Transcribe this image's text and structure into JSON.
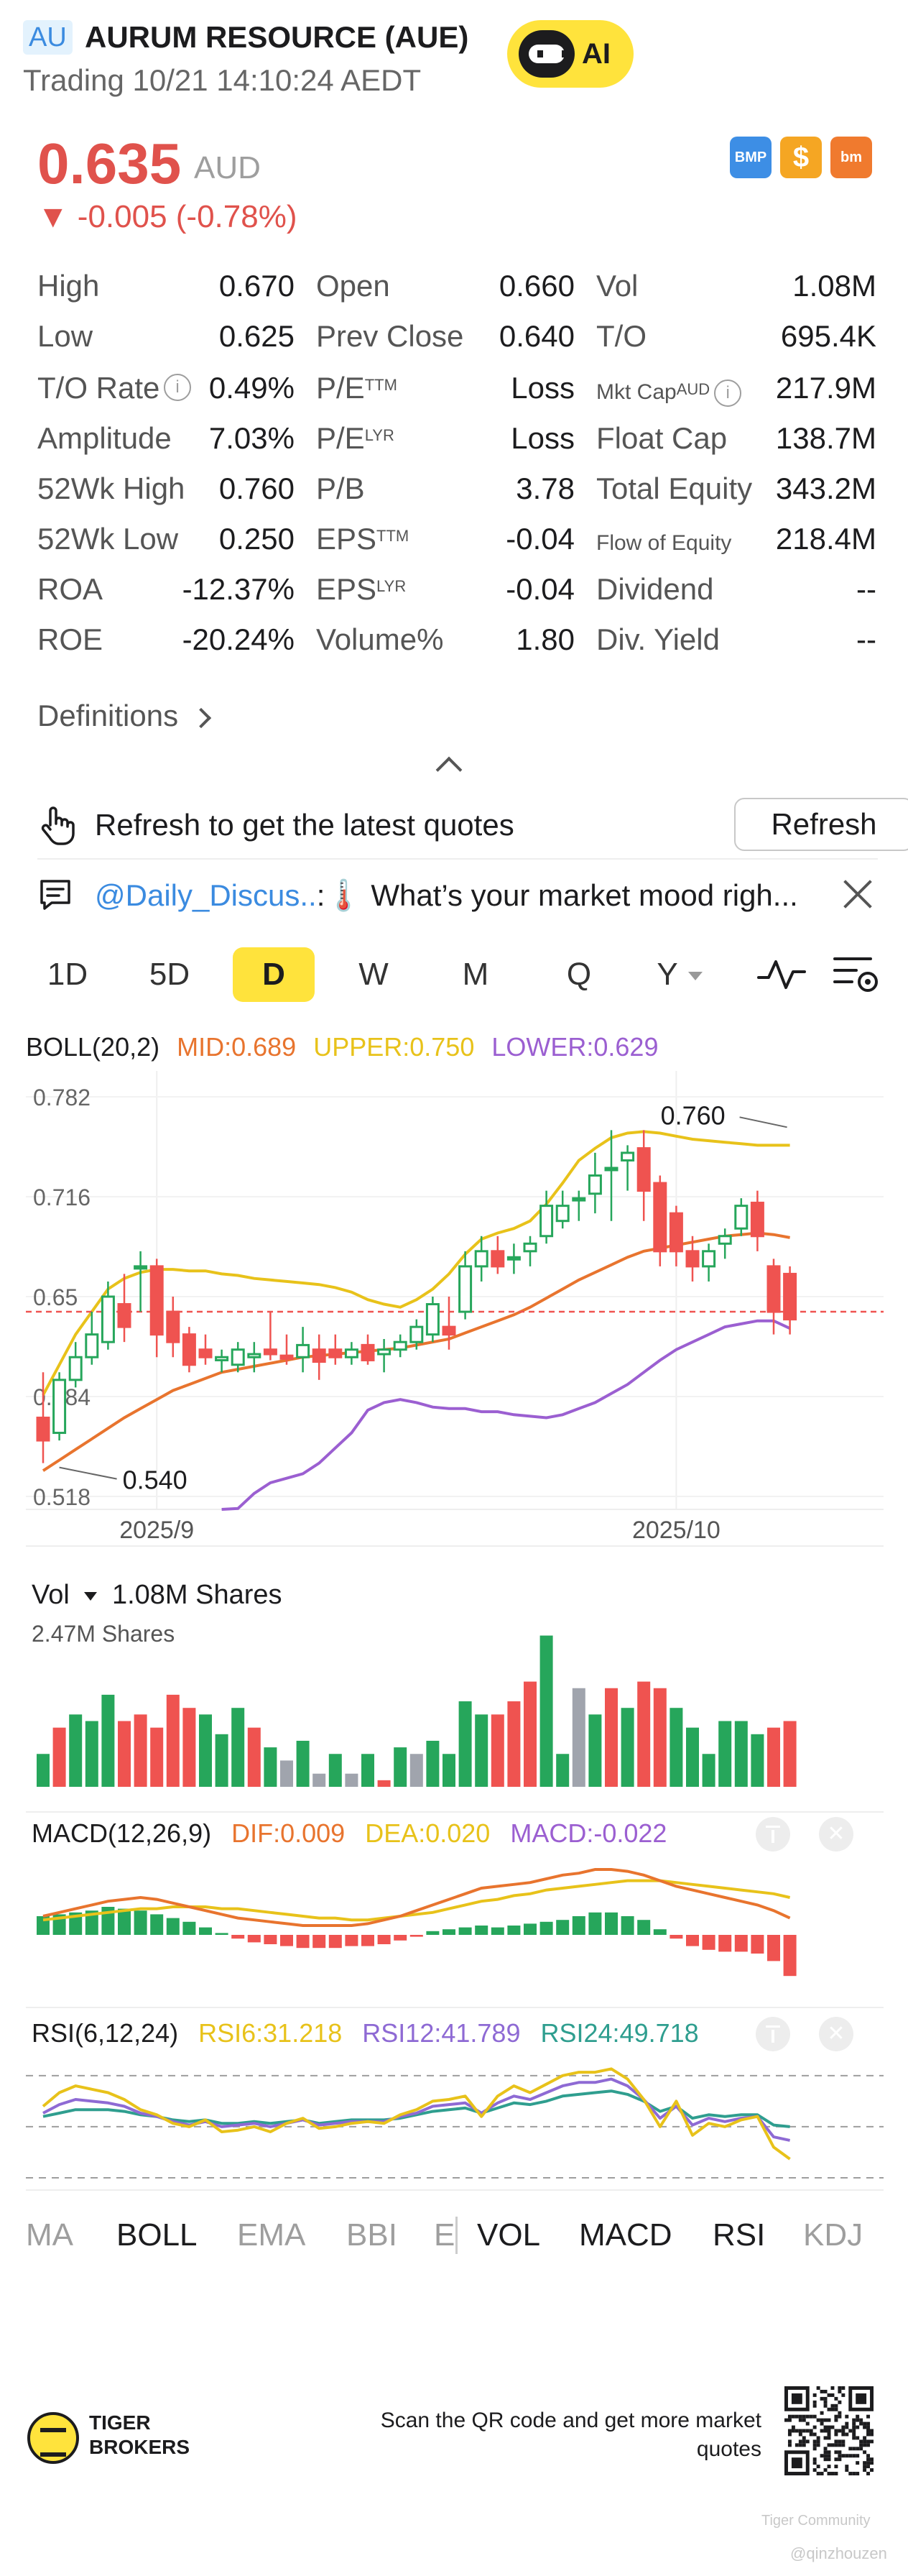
{
  "header": {
    "badge": "AU",
    "name": "AURUM RESOURCE (AUE)",
    "status": "Trading 10/21 14:10:24 AEDT",
    "ai_label": "AI"
  },
  "quote": {
    "price": "0.635",
    "currency": "AUD",
    "change": "-0.005 (-0.78%)",
    "icons": [
      "BMP",
      "$",
      "bm"
    ]
  },
  "stats": {
    "col1": [
      {
        "label": "High",
        "value": "0.670"
      },
      {
        "label": "Low",
        "value": "0.625"
      },
      {
        "label": "T/O Rate",
        "value": "0.49%"
      },
      {
        "label": "Amplitude",
        "value": "7.03%"
      },
      {
        "label": "52Wk High",
        "value": "0.760"
      },
      {
        "label": "52Wk Low",
        "value": "0.250"
      },
      {
        "label": "ROA",
        "value": "-12.37%"
      },
      {
        "label": "ROE",
        "value": "-20.24%"
      }
    ],
    "col2": [
      {
        "label": "Open",
        "sup": "",
        "value": "0.660"
      },
      {
        "label": "Prev Close",
        "sup": "",
        "value": "0.640"
      },
      {
        "label": "P/E",
        "sup": "TTM",
        "value": "Loss"
      },
      {
        "label": "P/E",
        "sup": "LYR",
        "value": "Loss"
      },
      {
        "label": "P/B",
        "sup": "",
        "value": "3.78"
      },
      {
        "label": "EPS",
        "sup": "TTM",
        "value": "-0.04"
      },
      {
        "label": "EPS",
        "sup": "LYR",
        "value": "-0.04"
      },
      {
        "label": "Volume%",
        "sup": "",
        "value": "1.80"
      }
    ],
    "col3": [
      {
        "label": "Vol",
        "value": "1.08M"
      },
      {
        "label": "T/O",
        "value": "695.4K"
      },
      {
        "label": "Mkt Cap",
        "sup": "AUD",
        "value": "217.9M"
      },
      {
        "label": "Float Cap",
        "value": "138.7M"
      },
      {
        "label": "Total Equity",
        "value": "343.2M"
      },
      {
        "label": "Flow of Equity",
        "value": "218.4M"
      },
      {
        "label": "Dividend",
        "value": "--"
      },
      {
        "label": "Div. Yield",
        "value": "--"
      }
    ],
    "definitions": "Definitions"
  },
  "refresh": {
    "text": "Refresh to get the latest quotes",
    "button": "Refresh"
  },
  "discussion": {
    "handle": "@Daily_Discus..",
    "text": ":🌡️ What’s your market mood righ..."
  },
  "periods": [
    "1D",
    "5D",
    "D",
    "W",
    "M",
    "Q",
    "Y"
  ],
  "active_period": "D",
  "boll": {
    "name": "BOLL(20,2)",
    "mid": "MID:0.689",
    "upper": "UPPER:0.750",
    "lower": "LOWER:0.629"
  },
  "vol_header": {
    "name": "Vol",
    "value": "1.08M Shares",
    "max_label": "2.47M Shares"
  },
  "macd": {
    "name": "MACD(12,26,9)",
    "dif": "DIF:0.009",
    "dea": "DEA:0.020",
    "macd": "MACD:-0.022"
  },
  "rsi": {
    "name": "RSI(6,12,24)",
    "rsi6": "RSI6:31.218",
    "rsi12": "RSI12:41.789",
    "rsi24": "RSI24:49.718"
  },
  "bottom_tabs": {
    "left": [
      "MA",
      "BOLL",
      "EMA",
      "BBI",
      "E"
    ],
    "right": [
      "VOL",
      "MACD",
      "RSI",
      "KDJ"
    ]
  },
  "footer": {
    "brand_line1": "TIGER",
    "brand_line2": "BROKERS",
    "scan_text": "Scan the QR code and get more market quotes",
    "watermark_1": "Tiger Community",
    "watermark_2": "@qinzhouzen"
  },
  "colors": {
    "up": "#26a65b",
    "down": "#ef5350",
    "neutral": "#a0a4ad",
    "mid": "#e8742e",
    "upper": "#e8c21a",
    "lower": "#9b5fd1",
    "rsi24": "#2f9e8f",
    "accent": "#ffe33c"
  },
  "chart_data": [
    {
      "type": "candlestick",
      "title": "BOLL(20,2)",
      "y_ticks": [
        0.782,
        0.716,
        0.65,
        0.584,
        0.518
      ],
      "ylim": [
        0.518,
        0.782
      ],
      "x_labels": [
        {
          "index": 7,
          "label": "2025/9"
        },
        {
          "index": 39,
          "label": "2025/10"
        }
      ],
      "annotations": [
        {
          "label": "0.760",
          "index": 46,
          "value": 0.76
        },
        {
          "label": "0.540",
          "index": 1,
          "value": 0.54
        }
      ],
      "reference_line": 0.64,
      "ohlc": [
        [
          0.57,
          0.6,
          0.54,
          0.555
        ],
        [
          0.56,
          0.6,
          0.555,
          0.595
        ],
        [
          0.595,
          0.62,
          0.59,
          0.61
        ],
        [
          0.61,
          0.64,
          0.605,
          0.625
        ],
        [
          0.62,
          0.66,
          0.615,
          0.65
        ],
        [
          0.645,
          0.665,
          0.62,
          0.63
        ],
        [
          0.67,
          0.68,
          0.64,
          0.67
        ],
        [
          0.67,
          0.675,
          0.61,
          0.625
        ],
        [
          0.64,
          0.65,
          0.61,
          0.62
        ],
        [
          0.625,
          0.63,
          0.6,
          0.605
        ],
        [
          0.615,
          0.625,
          0.605,
          0.61
        ],
        [
          0.608,
          0.615,
          0.6,
          0.61
        ],
        [
          0.605,
          0.62,
          0.6,
          0.615
        ],
        [
          0.61,
          0.62,
          0.6,
          0.612
        ],
        [
          0.615,
          0.64,
          0.608,
          0.612
        ],
        [
          0.611,
          0.625,
          0.605,
          0.609
        ],
        [
          0.61,
          0.63,
          0.6,
          0.618
        ],
        [
          0.615,
          0.625,
          0.595,
          0.607
        ],
        [
          0.615,
          0.625,
          0.605,
          0.61
        ],
        [
          0.61,
          0.62,
          0.605,
          0.615
        ],
        [
          0.618,
          0.625,
          0.605,
          0.608
        ],
        [
          0.612,
          0.622,
          0.6,
          0.615
        ],
        [
          0.615,
          0.625,
          0.61,
          0.62
        ],
        [
          0.62,
          0.635,
          0.615,
          0.63
        ],
        [
          0.625,
          0.65,
          0.62,
          0.645
        ],
        [
          0.63,
          0.65,
          0.615,
          0.625
        ],
        [
          0.64,
          0.68,
          0.635,
          0.67
        ],
        [
          0.67,
          0.69,
          0.66,
          0.68
        ],
        [
          0.68,
          0.69,
          0.665,
          0.67
        ],
        [
          0.675,
          0.685,
          0.665,
          0.676
        ],
        [
          0.68,
          0.69,
          0.67,
          0.685
        ],
        [
          0.69,
          0.72,
          0.685,
          0.71
        ],
        [
          0.7,
          0.72,
          0.695,
          0.71
        ],
        [
          0.715,
          0.72,
          0.7,
          0.715
        ],
        [
          0.718,
          0.745,
          0.705,
          0.73
        ],
        [
          0.735,
          0.76,
          0.7,
          0.735
        ],
        [
          0.74,
          0.75,
          0.72,
          0.745
        ],
        [
          0.748,
          0.76,
          0.7,
          0.72
        ],
        [
          0.725,
          0.73,
          0.67,
          0.68
        ],
        [
          0.705,
          0.71,
          0.67,
          0.68
        ],
        [
          0.68,
          0.69,
          0.66,
          0.67
        ],
        [
          0.67,
          0.685,
          0.66,
          0.68
        ],
        [
          0.685,
          0.695,
          0.675,
          0.69
        ],
        [
          0.695,
          0.715,
          0.69,
          0.71
        ],
        [
          0.712,
          0.72,
          0.68,
          0.69
        ],
        [
          0.67,
          0.675,
          0.625,
          0.64
        ],
        [
          0.665,
          0.67,
          0.625,
          0.635
        ]
      ],
      "boll_mid": [
        0.535,
        0.542,
        0.549,
        0.556,
        0.563,
        0.57,
        0.576,
        0.582,
        0.588,
        0.592,
        0.596,
        0.6,
        0.602,
        0.604,
        0.606,
        0.608,
        0.61,
        0.611,
        0.612,
        0.613,
        0.614,
        0.615,
        0.616,
        0.618,
        0.62,
        0.622,
        0.626,
        0.63,
        0.634,
        0.638,
        0.643,
        0.649,
        0.655,
        0.661,
        0.666,
        0.671,
        0.676,
        0.68,
        0.682,
        0.684,
        0.686,
        0.688,
        0.69,
        0.691,
        0.692,
        0.691,
        0.689
      ],
      "boll_upper": [
        0.585,
        0.605,
        0.625,
        0.64,
        0.655,
        0.662,
        0.666,
        0.668,
        0.668,
        0.667,
        0.667,
        0.665,
        0.664,
        0.662,
        0.661,
        0.66,
        0.659,
        0.658,
        0.656,
        0.653,
        0.648,
        0.645,
        0.643,
        0.648,
        0.655,
        0.665,
        0.678,
        0.688,
        0.692,
        0.695,
        0.7,
        0.711,
        0.725,
        0.74,
        0.748,
        0.755,
        0.758,
        0.759,
        0.758,
        0.756,
        0.754,
        0.753,
        0.752,
        0.751,
        0.75,
        0.75,
        0.75
      ],
      "boll_lower": [
        null,
        null,
        null,
        null,
        null,
        null,
        null,
        null,
        null,
        null,
        null,
        0.5,
        0.51,
        0.52,
        0.527,
        0.53,
        0.533,
        0.54,
        0.55,
        0.56,
        0.575,
        0.58,
        0.582,
        0.58,
        0.577,
        0.576,
        0.576,
        0.574,
        0.574,
        0.572,
        0.571,
        0.57,
        0.572,
        0.576,
        0.58,
        0.586,
        0.592,
        0.6,
        0.608,
        0.615,
        0.62,
        0.625,
        0.63,
        0.632,
        0.634,
        0.634,
        0.629
      ]
    },
    {
      "type": "bar",
      "title": "Vol",
      "unit": "Shares",
      "ymax_label": "2.47M Shares",
      "values": [
        0.5,
        0.9,
        1.1,
        1.0,
        1.4,
        1.0,
        1.1,
        0.9,
        1.4,
        1.2,
        1.1,
        0.8,
        1.2,
        0.9,
        0.6,
        0.4,
        0.7,
        0.2,
        0.5,
        0.2,
        0.5,
        0.1,
        0.6,
        0.5,
        0.7,
        0.5,
        1.3,
        1.1,
        1.1,
        1.3,
        1.6,
        2.3,
        0.5,
        1.5,
        1.1,
        1.5,
        1.2,
        1.6,
        1.5,
        1.2,
        0.9,
        0.5,
        1.0,
        1.0,
        0.8,
        0.9,
        1.0
      ],
      "direction": [
        "up",
        "down",
        "up",
        "up",
        "up",
        "down",
        "down",
        "down",
        "down",
        "down",
        "up",
        "up",
        "up",
        "down",
        "up",
        "neutral",
        "up",
        "neutral",
        "up",
        "neutral",
        "up",
        "down",
        "up",
        "neutral",
        "up",
        "up",
        "up",
        "up",
        "down",
        "down",
        "down",
        "up",
        "up",
        "neutral",
        "up",
        "down",
        "up",
        "down",
        "down",
        "up",
        "up",
        "up",
        "up",
        "up",
        "up",
        "down",
        "down"
      ]
    },
    {
      "type": "bar",
      "title": "MACD(12,26,9)",
      "macd": [
        0.01,
        0.011,
        0.012,
        0.013,
        0.015,
        0.014,
        0.013,
        0.011,
        0.009,
        0.007,
        0.004,
        0.001,
        -0.002,
        -0.004,
        -0.005,
        -0.006,
        -0.007,
        -0.007,
        -0.007,
        -0.006,
        -0.006,
        -0.005,
        -0.003,
        -0.001,
        0.002,
        0.003,
        0.004,
        0.005,
        0.004,
        0.005,
        0.006,
        0.007,
        0.008,
        0.01,
        0.012,
        0.012,
        0.01,
        0.008,
        0.003,
        -0.002,
        -0.006,
        -0.008,
        -0.009,
        -0.009,
        -0.01,
        -0.014,
        -0.022
      ],
      "dif": [
        0.01,
        0.012,
        0.014,
        0.016,
        0.018,
        0.019,
        0.02,
        0.019,
        0.017,
        0.015,
        0.013,
        0.011,
        0.009,
        0.008,
        0.007,
        0.006,
        0.005,
        0.005,
        0.005,
        0.005,
        0.006,
        0.008,
        0.01,
        0.013,
        0.016,
        0.019,
        0.022,
        0.025,
        0.026,
        0.027,
        0.028,
        0.03,
        0.032,
        0.033,
        0.035,
        0.035,
        0.034,
        0.032,
        0.029,
        0.026,
        0.024,
        0.022,
        0.02,
        0.018,
        0.016,
        0.013,
        0.009
      ],
      "dea": [
        0.008,
        0.009,
        0.01,
        0.011,
        0.012,
        0.013,
        0.014,
        0.014,
        0.015,
        0.015,
        0.015,
        0.014,
        0.014,
        0.013,
        0.012,
        0.011,
        0.01,
        0.009,
        0.009,
        0.008,
        0.008,
        0.009,
        0.01,
        0.011,
        0.012,
        0.014,
        0.016,
        0.018,
        0.019,
        0.021,
        0.022,
        0.024,
        0.025,
        0.026,
        0.027,
        0.028,
        0.029,
        0.029,
        0.029,
        0.028,
        0.027,
        0.026,
        0.025,
        0.024,
        0.023,
        0.022,
        0.02
      ]
    },
    {
      "type": "line",
      "title": "RSI(6,12,24)",
      "ylim": [
        20,
        85
      ],
      "ref_lines": [
        80,
        50,
        20
      ],
      "rsi6": [
        62,
        70,
        74,
        72,
        70,
        66,
        60,
        57,
        52,
        50,
        54,
        47,
        48,
        50,
        47,
        52,
        55,
        49,
        50,
        52,
        53,
        52,
        57,
        60,
        65,
        66,
        68,
        56,
        68,
        74,
        70,
        75,
        80,
        82,
        82,
        84,
        78,
        66,
        50,
        65,
        45,
        52,
        50,
        54,
        56,
        38,
        31
      ],
      "rsi12": [
        58,
        63,
        66,
        65,
        64,
        62,
        58,
        56,
        53,
        51,
        53,
        50,
        51,
        52,
        50,
        52,
        54,
        51,
        52,
        53,
        53,
        53,
        56,
        58,
        62,
        63,
        64,
        58,
        64,
        68,
        66,
        70,
        74,
        76,
        76,
        78,
        74,
        66,
        55,
        62,
        51,
        55,
        53,
        55,
        56,
        44,
        42
      ],
      "rsi24": [
        56,
        58,
        60,
        60,
        60,
        59,
        57,
        56,
        54,
        53,
        54,
        52,
        52,
        53,
        52,
        53,
        54,
        52,
        53,
        54,
        54,
        54,
        55,
        57,
        59,
        60,
        61,
        58,
        61,
        64,
        63,
        65,
        68,
        69,
        70,
        71,
        69,
        65,
        59,
        62,
        55,
        57,
        56,
        57,
        57,
        51,
        50
      ]
    }
  ]
}
